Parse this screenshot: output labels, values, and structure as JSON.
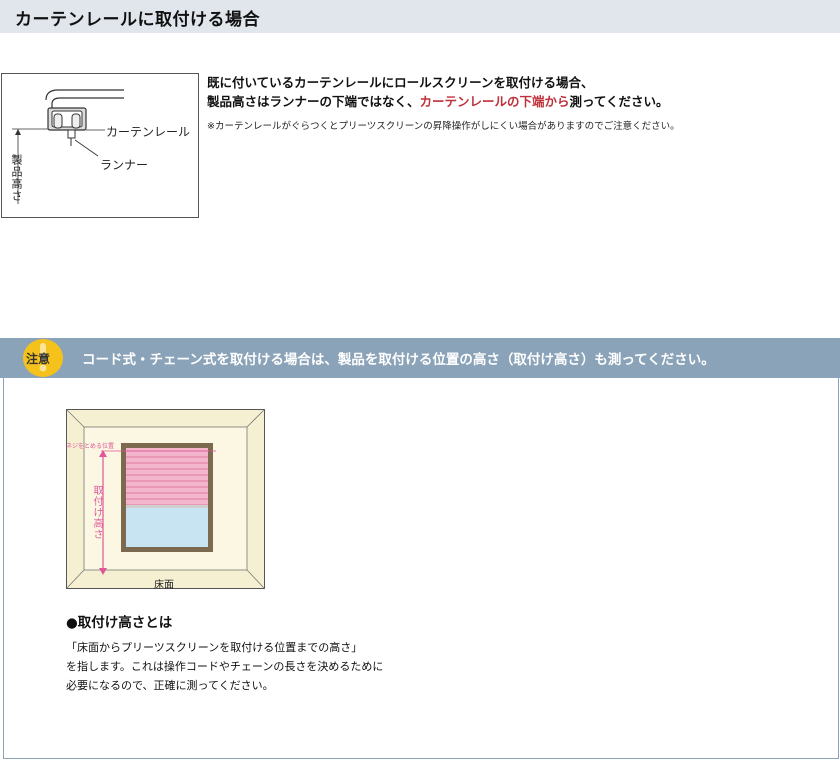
{
  "title": "カーテンレールに取付ける場合",
  "rail_diagram": {
    "label_rail": "カーテンレール",
    "label_runner": "ランナー",
    "label_height": "製品高さ"
  },
  "description": {
    "line1": "既に付いているカーテンレールにロールスクリーンを取付ける場合、",
    "line2_a": "製品高さはランナーの下端ではなく、",
    "line2_red": "カーテンレールの下端から",
    "line2_b": "測ってください。",
    "note": "※カーテンレールがぐらつくとプリーツスクリーンの昇降操作がしにくい場合がありますのでご注意ください。"
  },
  "caution": {
    "badge": "注意",
    "text": "コード式・チェーン式を取付ける場合は、製品を取付ける位置の高さ（取付け高さ）も測ってください。"
  },
  "room_diagram": {
    "label_screw": "ネジをとめる位置",
    "label_height": "取付け高さ",
    "label_floor": "床面"
  },
  "definition": {
    "heading": "●取付け高さとは",
    "line1": "「床面からプリーツスクリーンを取付ける位置までの高さ」",
    "line2": "を指します。これは操作コードやチェーンの長さを決めるために",
    "line3": "必要になるので、正確に測ってください。"
  },
  "colors": {
    "title_bar": "#e1e6ec",
    "caution_bar": "#8aa3b8",
    "badge": "#f5c21b",
    "accent_red": "#c0303b",
    "pink": "#e0569b",
    "wall": "#f6f0d2",
    "frame": "#7c6a50",
    "glass": "#c8e4f2"
  }
}
